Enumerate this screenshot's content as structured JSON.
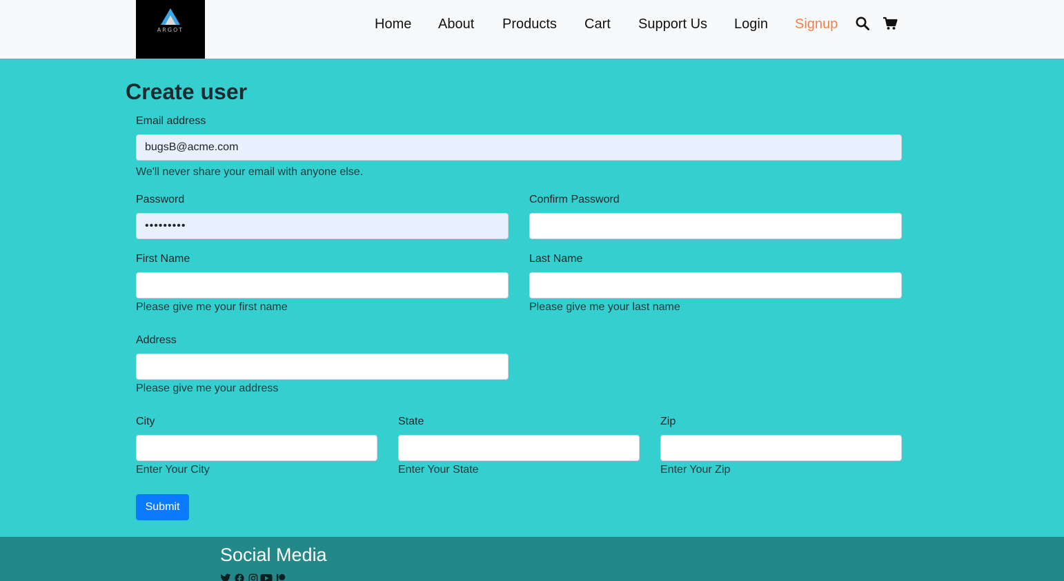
{
  "brand": {
    "logo_text": "ARGOT"
  },
  "nav": {
    "home": "Home",
    "about": "About",
    "products": "Products",
    "cart": "Cart",
    "support": "Support Us",
    "login": "Login",
    "signup": "Signup",
    "active_color": "#f2804a"
  },
  "form": {
    "title": "Create user",
    "email": {
      "label": "Email address",
      "value": "bugsB@acme.com",
      "help": "We'll never share your email with anyone else."
    },
    "password": {
      "label": "Password",
      "value": "password1"
    },
    "confirm_password": {
      "label": "Confirm Password",
      "value": ""
    },
    "first_name": {
      "label": "First Name",
      "value": "",
      "help": "Please give me your first name"
    },
    "last_name": {
      "label": "Last Name",
      "value": "",
      "help": "Please give me your last name"
    },
    "address": {
      "label": "Address",
      "value": "",
      "help": "Please give me your address"
    },
    "city": {
      "label": "City",
      "value": "",
      "help": "Enter Your City"
    },
    "state": {
      "label": "State",
      "value": "",
      "help": "Enter Your State"
    },
    "zip": {
      "label": "Zip",
      "value": "",
      "help": "Enter Your Zip"
    },
    "submit_label": "Submit"
  },
  "footer": {
    "title": "Social Media",
    "icons": [
      "twitter-icon",
      "facebook-icon",
      "instagram-icon",
      "youtube-icon",
      "patreon-icon"
    ]
  },
  "colors": {
    "page_bg": "#36cfcf",
    "footer_bg": "#228888",
    "button": "#0a7bff"
  }
}
